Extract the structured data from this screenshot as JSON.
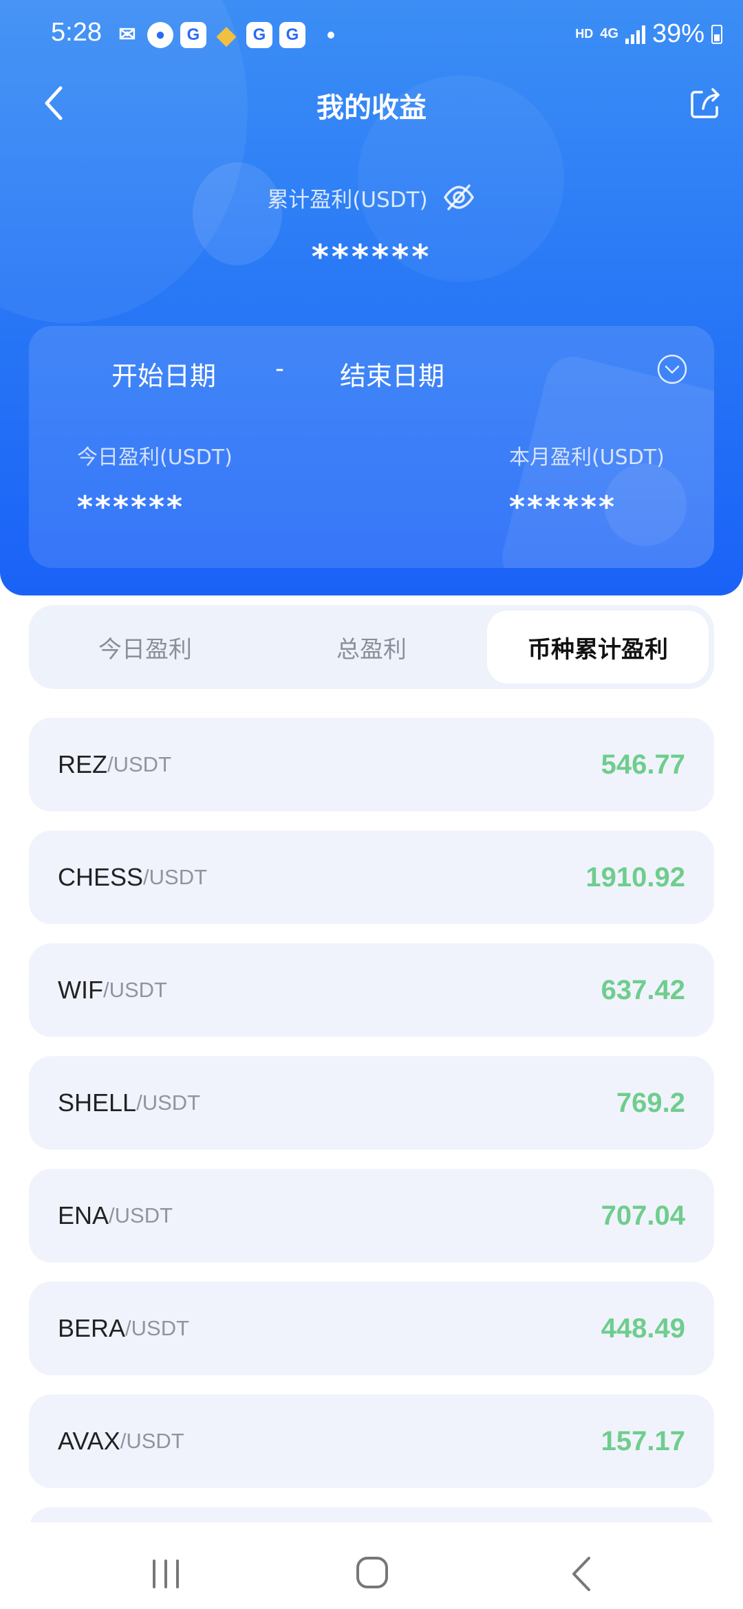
{
  "status_bar": {
    "time": "5:28",
    "hd_label": "HD",
    "network_label": "4G",
    "battery": "39%"
  },
  "header": {
    "title": "我的收益"
  },
  "total_profit": {
    "label": "累计盈利(USDT)",
    "value": "******"
  },
  "date_range": {
    "start": "开始日期",
    "separator": "-",
    "end": "结束日期"
  },
  "today_profit": {
    "label": "今日盈利(USDT)",
    "value": "******"
  },
  "month_profit": {
    "label": "本月盈利(USDT)",
    "value": "******"
  },
  "tabs": [
    {
      "label": "今日盈利",
      "active": false
    },
    {
      "label": "总盈利",
      "active": false
    },
    {
      "label": "币种累计盈利",
      "active": true
    }
  ],
  "pairs": [
    {
      "base": "REZ",
      "quote": "/USDT",
      "value": "546.77"
    },
    {
      "base": "CHESS",
      "quote": "/USDT",
      "value": "1910.92"
    },
    {
      "base": "WIF",
      "quote": "/USDT",
      "value": "637.42"
    },
    {
      "base": "SHELL",
      "quote": "/USDT",
      "value": "769.2"
    },
    {
      "base": "ENA",
      "quote": "/USDT",
      "value": "707.04"
    },
    {
      "base": "BERA",
      "quote": "/USDT",
      "value": "448.49"
    },
    {
      "base": "AVAX",
      "quote": "/USDT",
      "value": "157.17"
    }
  ],
  "colors": {
    "header_blue": "#2a7af6",
    "profit_green": "#6fcd8d",
    "row_bg": "#f0f3fc"
  },
  "icons": {
    "back": "chevron-left-icon",
    "share": "share-icon",
    "eye": "eye-slash-icon",
    "date_toggle": "chevron-down-circle-icon"
  }
}
